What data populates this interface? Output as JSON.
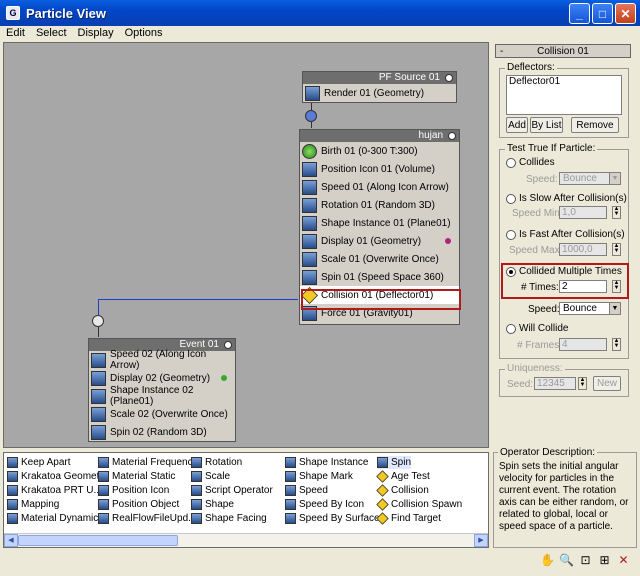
{
  "window": {
    "title": "Particle View"
  },
  "menu": [
    "Edit",
    "Select",
    "Display",
    "Options"
  ],
  "nodes": {
    "pfsource": {
      "header": "PF Source 01",
      "ops": [
        {
          "label": "Render 01 (Geometry)",
          "icon": "render-icon"
        }
      ]
    },
    "hujan": {
      "header": "hujan",
      "ops": [
        {
          "label": "Birth 01 (0-300 T:300)",
          "icon": "birth-icon"
        },
        {
          "label": "Position Icon 01 (Volume)",
          "icon": "position-icon"
        },
        {
          "label": "Speed 01 (Along Icon Arrow)",
          "icon": "speed-icon"
        },
        {
          "label": "Rotation 01 (Random 3D)",
          "icon": "rotation-icon"
        },
        {
          "label": "Shape Instance 01 (Plane01)",
          "icon": "shape-instance-icon"
        },
        {
          "label": "Display 01 (Geometry)",
          "icon": "display-icon",
          "dot": "#b0237a"
        },
        {
          "label": "Scale 01 (Overwrite Once)",
          "icon": "scale-icon"
        },
        {
          "label": "Spin 01 (Speed Space 360)",
          "icon": "spin-icon"
        },
        {
          "label": "Collision 01 (Deflector01)",
          "icon": "collision-icon",
          "selected": true
        },
        {
          "label": "Force 01 (Gravity01)",
          "icon": "force-icon"
        }
      ]
    },
    "event": {
      "header": "Event 01",
      "ops": [
        {
          "label": "Speed 02 (Along Icon Arrow)",
          "icon": "speed-icon"
        },
        {
          "label": "Display 02 (Geometry)",
          "icon": "display-icon",
          "dot": "#3aa82a"
        },
        {
          "label": "Shape Instance 02 (Plane01)",
          "icon": "shape-instance-icon"
        },
        {
          "label": "Scale 02 (Overwrite Once)",
          "icon": "scale-icon"
        },
        {
          "label": "Spin 02 (Random 3D)",
          "icon": "spin-icon"
        }
      ]
    }
  },
  "panel": {
    "rollout_title": "Collision 01",
    "minus": "-",
    "deflectors_label": "Deflectors:",
    "deflector_item": "Deflector01",
    "btn_add": "Add",
    "btn_bylist": "By List",
    "btn_remove": "Remove",
    "test_label": "Test True If Particle:",
    "collides": "Collides",
    "speed_label": "Speed:",
    "speed_bounce_disabled": "Bounce",
    "slow_after": "Is Slow After Collision(s)",
    "speed_min_label": "Speed Min:",
    "speed_min_val": "1,0",
    "fast_after": "Is Fast After Collision(s)",
    "speed_max_label": "Speed Max:",
    "speed_max_val": "1000,0",
    "collided_multiple": "Collided Multiple Times",
    "times_label": "# Times:",
    "times_val": "2",
    "speed_bounce": "Bounce",
    "will_collide": "Will Collide",
    "frames_label": "# Frames:",
    "frames_val": "4",
    "uniqueness_label": "Uniqueness:",
    "seed_label": "Seed:",
    "seed_val": "12345",
    "btn_new": "New"
  },
  "depot": [
    {
      "label": "Keep Apart",
      "icon": "keep-apart-icon"
    },
    {
      "label": "Krakatoa Geomet...",
      "icon": "krakatoa-geometry-icon"
    },
    {
      "label": "Krakatoa PRT U...",
      "icon": "krakatoa-prt-icon"
    },
    {
      "label": "Mapping",
      "icon": "mapping-icon"
    },
    {
      "label": "Material Dynamic",
      "icon": "material-dynamic-icon"
    },
    {
      "label": "Material Frequency",
      "icon": "material-frequency-icon"
    },
    {
      "label": "Material Static",
      "icon": "material-static-icon"
    },
    {
      "label": "Position Icon",
      "icon": "position-icon"
    },
    {
      "label": "Position Object",
      "icon": "position-object-icon"
    },
    {
      "label": "RealFlowFileUpd...",
      "icon": "realflow-icon"
    },
    {
      "label": "Rotation",
      "icon": "rotation-icon"
    },
    {
      "label": "Scale",
      "icon": "scale-icon"
    },
    {
      "label": "Script Operator",
      "icon": "script-operator-icon"
    },
    {
      "label": "Shape",
      "icon": "shape-icon"
    },
    {
      "label": "Shape Facing",
      "icon": "shape-facing-icon"
    },
    {
      "label": "Shape Instance",
      "icon": "shape-instance-icon"
    },
    {
      "label": "Shape Mark",
      "icon": "shape-mark-icon"
    },
    {
      "label": "Speed",
      "icon": "speed-icon"
    },
    {
      "label": "Speed By Icon",
      "icon": "speed-by-icon-icon"
    },
    {
      "label": "Speed By Surface",
      "icon": "speed-by-surface-icon"
    },
    {
      "label": "Spin",
      "icon": "spin-icon"
    },
    {
      "label": "Age Test",
      "icon": "age-test-icon"
    },
    {
      "label": "Collision",
      "icon": "collision-icon"
    },
    {
      "label": "Collision Spawn",
      "icon": "collision-spawn-icon"
    },
    {
      "label": "Find Target",
      "icon": "find-target-icon"
    }
  ],
  "description": {
    "label": "Operator Description:",
    "text": "Spin sets the initial angular velocity for particles in the current event. The rotation axis can be either random, or related to global, local or speed space of a particle."
  },
  "toolbar": [
    "pan-icon",
    "zoom-icon",
    "zoom-region-icon",
    "zoom-extents-icon",
    "no-zoom-icon"
  ]
}
